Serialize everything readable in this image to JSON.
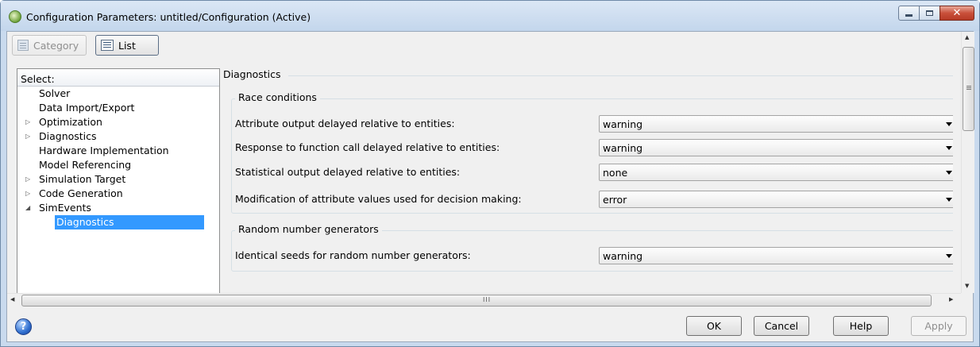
{
  "window": {
    "title": "Configuration Parameters: untitled/Configuration (Active)",
    "close_glyph": "✕"
  },
  "toolbar": {
    "category_label": "Category",
    "list_label": "List"
  },
  "select_panel": {
    "header": "Select:",
    "items": [
      {
        "label": "Solver",
        "arrow": ""
      },
      {
        "label": "Data Import/Export",
        "arrow": ""
      },
      {
        "label": "Optimization",
        "arrow": "▷"
      },
      {
        "label": "Diagnostics",
        "arrow": "▷"
      },
      {
        "label": "Hardware Implementation",
        "arrow": ""
      },
      {
        "label": "Model Referencing",
        "arrow": ""
      },
      {
        "label": "Simulation Target",
        "arrow": "▷"
      },
      {
        "label": "Code Generation",
        "arrow": "▷"
      },
      {
        "label": "SimEvents",
        "arrow": "◢"
      },
      {
        "label": "Diagnostics",
        "arrow": ""
      }
    ],
    "selected_index": 9
  },
  "main": {
    "section_title": "Diagnostics",
    "groups": [
      {
        "title": "Race conditions",
        "rows": [
          {
            "label": "Attribute output delayed relative to entities:",
            "value": "warning"
          },
          {
            "label": "Response to function call delayed relative to entities:",
            "value": "warning"
          },
          {
            "label": "Statistical output delayed relative to entities:",
            "value": "none"
          },
          {
            "label": "Modification of attribute values used for decision making:",
            "value": "error"
          }
        ]
      },
      {
        "title": "Random number generators",
        "rows": [
          {
            "label": "Identical seeds for random number generators:",
            "value": "warning"
          }
        ]
      }
    ]
  },
  "scroll": {
    "hgrip": "III"
  },
  "footer": {
    "help_glyph": "?",
    "ok_label": "OK",
    "cancel_label": "Cancel",
    "help_label": "Help",
    "apply_label": "Apply"
  }
}
